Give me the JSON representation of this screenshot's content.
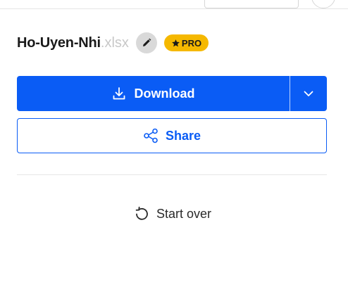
{
  "file": {
    "name": "Ho-Uyen-Nhi",
    "extension": ".xlsx",
    "badge_label": "PRO"
  },
  "actions": {
    "download_label": "Download",
    "share_label": "Share",
    "start_over_label": "Start over"
  },
  "icons": {
    "edit": "pencil-icon",
    "badge": "star-icon",
    "download": "download-icon",
    "dropdown": "chevron-down-icon",
    "share": "share-icon",
    "start_over": "rotate-left-icon"
  },
  "colors": {
    "primary": "#0a5cf5",
    "badge": "#f5b800",
    "extension_text": "#c8c8c8",
    "edit_bg": "#d9d9d9"
  }
}
